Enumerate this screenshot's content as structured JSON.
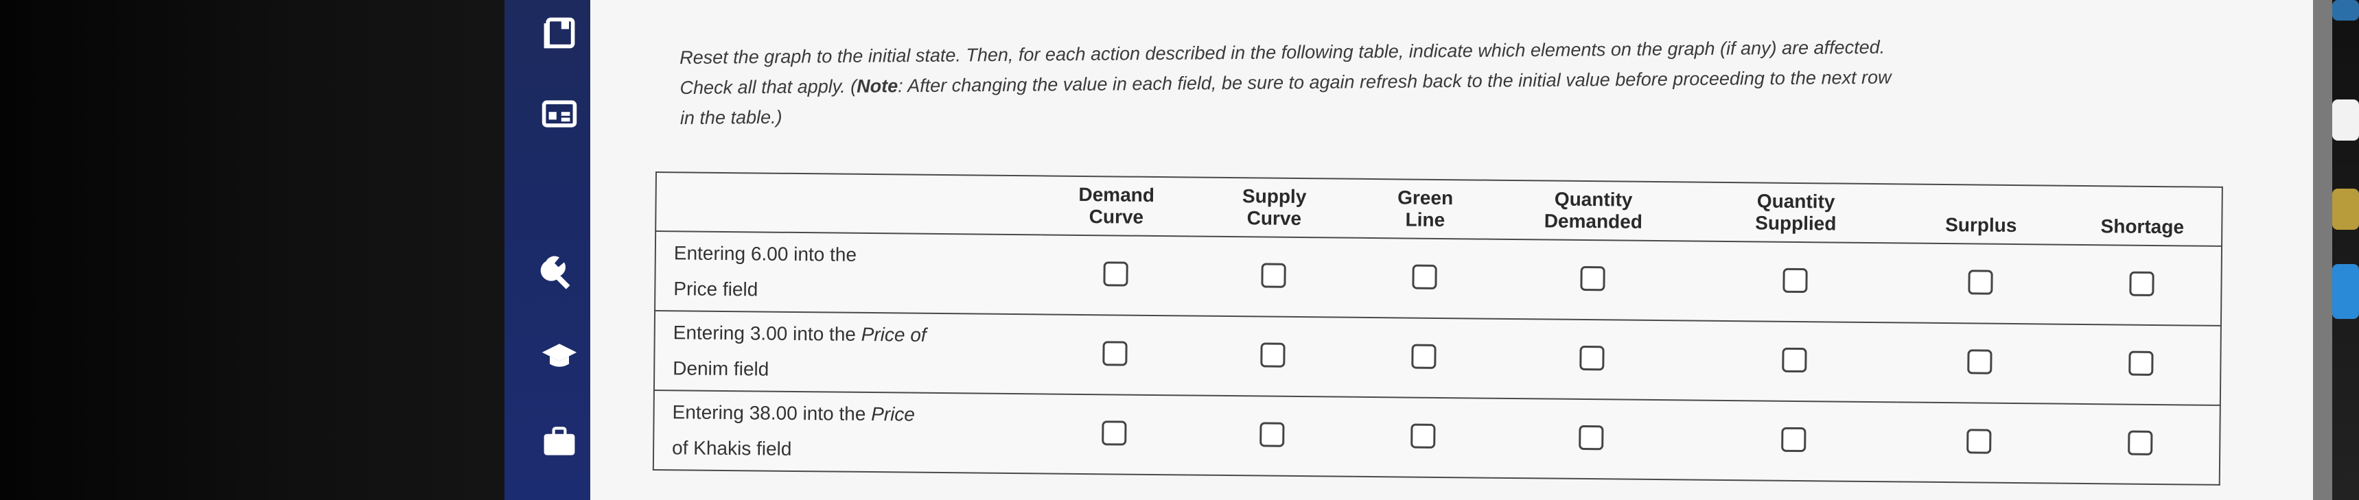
{
  "sidebar": {
    "icons": [
      "book-icon",
      "calculator-icon",
      "wrench-icon",
      "graduation-cap-icon",
      "briefcase-icon"
    ]
  },
  "instructions": {
    "line1": "Reset the graph to the initial state. Then, for each action described in the following table, indicate which elements on the graph (if any) are affected.",
    "line2_a": "Check all that apply. (",
    "note_label": "Note",
    "line2_b": ": After changing the value in each field, be sure to again refresh back to the initial value before proceeding to the next row",
    "line3": "in the table.)"
  },
  "table": {
    "columns": [
      {
        "line1": "Demand",
        "line2": "Curve"
      },
      {
        "line1": "Supply",
        "line2": "Curve"
      },
      {
        "line1": "Green",
        "line2": "Line"
      },
      {
        "line1": "Quantity",
        "line2": "Demanded"
      },
      {
        "line1": "Quantity",
        "line2": "Supplied"
      },
      {
        "line1": "",
        "line2": "Surplus"
      },
      {
        "line1": "",
        "line2": "Shortage"
      }
    ],
    "rows": [
      {
        "pre": "Entering 6.00 into the",
        "field": "",
        "post": "Price field",
        "checked": [
          false,
          false,
          false,
          false,
          false,
          false,
          false
        ]
      },
      {
        "pre": "Entering 3.00 into the",
        "field": "Price of",
        "post": "Denim field",
        "checked": [
          false,
          false,
          false,
          false,
          false,
          false,
          false
        ]
      },
      {
        "pre": "Entering 38.00 into the",
        "field": "Price",
        "post": "of Khakis field",
        "checked": [
          false,
          false,
          false,
          false,
          false,
          false,
          false
        ]
      }
    ]
  }
}
